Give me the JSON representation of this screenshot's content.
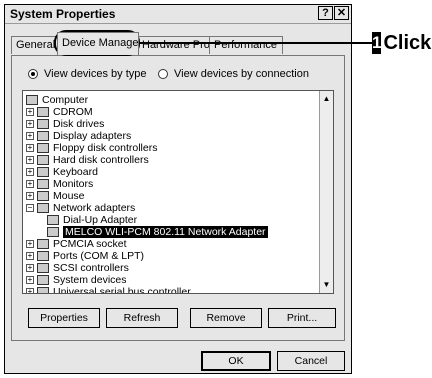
{
  "window": {
    "title": "System Properties",
    "help_label": "?",
    "close_label": "✕"
  },
  "tabs": [
    {
      "label": "General"
    },
    {
      "label": "Device Manager"
    },
    {
      "label": "Hardware Profiles"
    },
    {
      "label": "Performance"
    }
  ],
  "view": {
    "by_type": "View devices by type",
    "by_connection": "View devices by connection"
  },
  "tree": [
    {
      "label": "Computer"
    },
    {
      "label": "CDROM"
    },
    {
      "label": "Disk drives"
    },
    {
      "label": "Display adapters"
    },
    {
      "label": "Floppy disk controllers"
    },
    {
      "label": "Hard disk controllers"
    },
    {
      "label": "Keyboard"
    },
    {
      "label": "Monitors"
    },
    {
      "label": "Mouse"
    },
    {
      "label": "Network adapters"
    },
    {
      "label": "Dial-Up Adapter"
    },
    {
      "label": "MELCO WLI-PCM 802.11 Network Adapter"
    },
    {
      "label": "PCMCIA socket"
    },
    {
      "label": "Ports (COM & LPT)"
    },
    {
      "label": "SCSI controllers"
    },
    {
      "label": "System devices"
    },
    {
      "label": "Universal serial bus controller"
    }
  ],
  "buttons": {
    "properties": "Properties",
    "refresh": "Refresh",
    "remove": "Remove",
    "print": "Print...",
    "ok": "OK",
    "cancel": "Cancel"
  },
  "callout": {
    "step": "1",
    "action": "Click"
  }
}
